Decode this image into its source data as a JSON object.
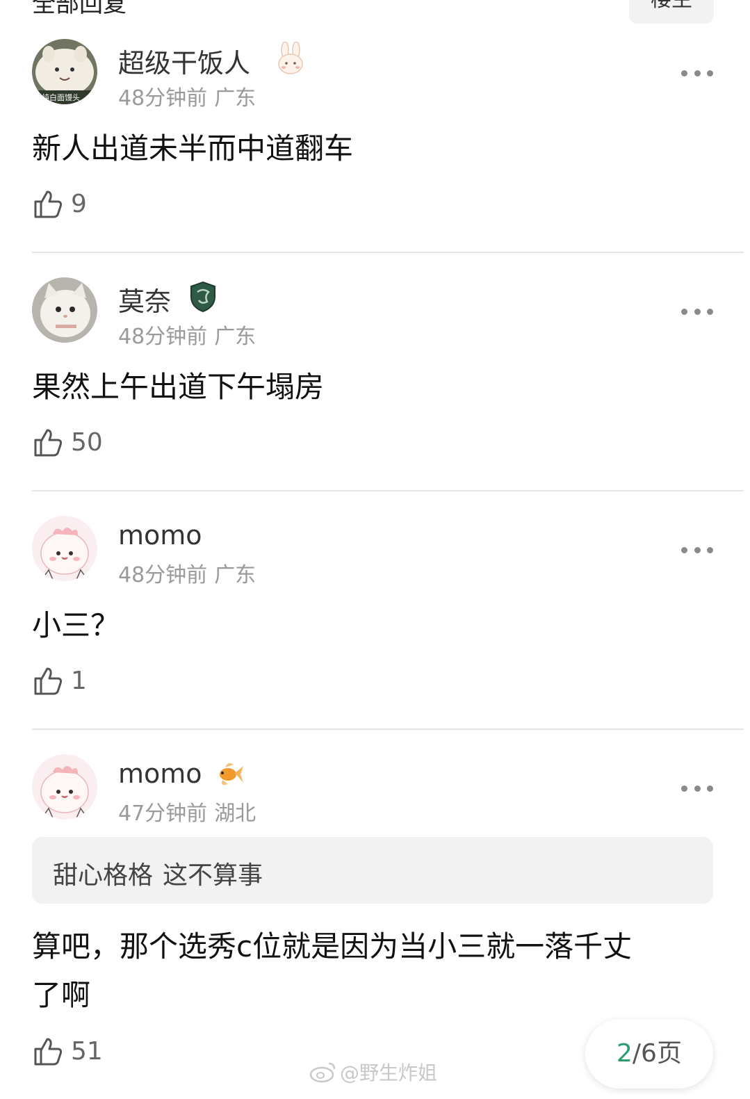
{
  "header": {
    "title": "全部回复",
    "sort_label": "楼主"
  },
  "comments": [
    {
      "username": "超级干饭人",
      "time": "48分钟前",
      "location": "广东",
      "text": "新人出道未半而中道翻车",
      "likes": "9",
      "avatar_caption": "纯白面馒头"
    },
    {
      "username": "莫奈",
      "time": "48分钟前",
      "location": "广东",
      "text": "果然上午出道下午塌房",
      "likes": "50"
    },
    {
      "username": "momo",
      "time": "48分钟前",
      "location": "广东",
      "text": "小三？",
      "likes": "1"
    },
    {
      "username": "momo",
      "time": "47分钟前",
      "location": "湖北",
      "quote": {
        "user": "甜心格格",
        "text": "这不算事"
      },
      "text_line1": "算吧，那个选秀c位就是因为当小三就一落千丈",
      "text_line2": "了啊",
      "likes": "51"
    }
  ],
  "pager": {
    "current": "2",
    "rest": "/6页"
  },
  "watermark": "@野生炸姐",
  "colors": {
    "accent": "#2a9d6e",
    "divider": "#e6e6e6",
    "meta": "#9a9a9a"
  },
  "icons": [
    "more-icon",
    "thumb-up-icon",
    "rabbit-badge-icon",
    "shield-badge-icon",
    "goldfish-badge-icon",
    "weibo-icon"
  ]
}
